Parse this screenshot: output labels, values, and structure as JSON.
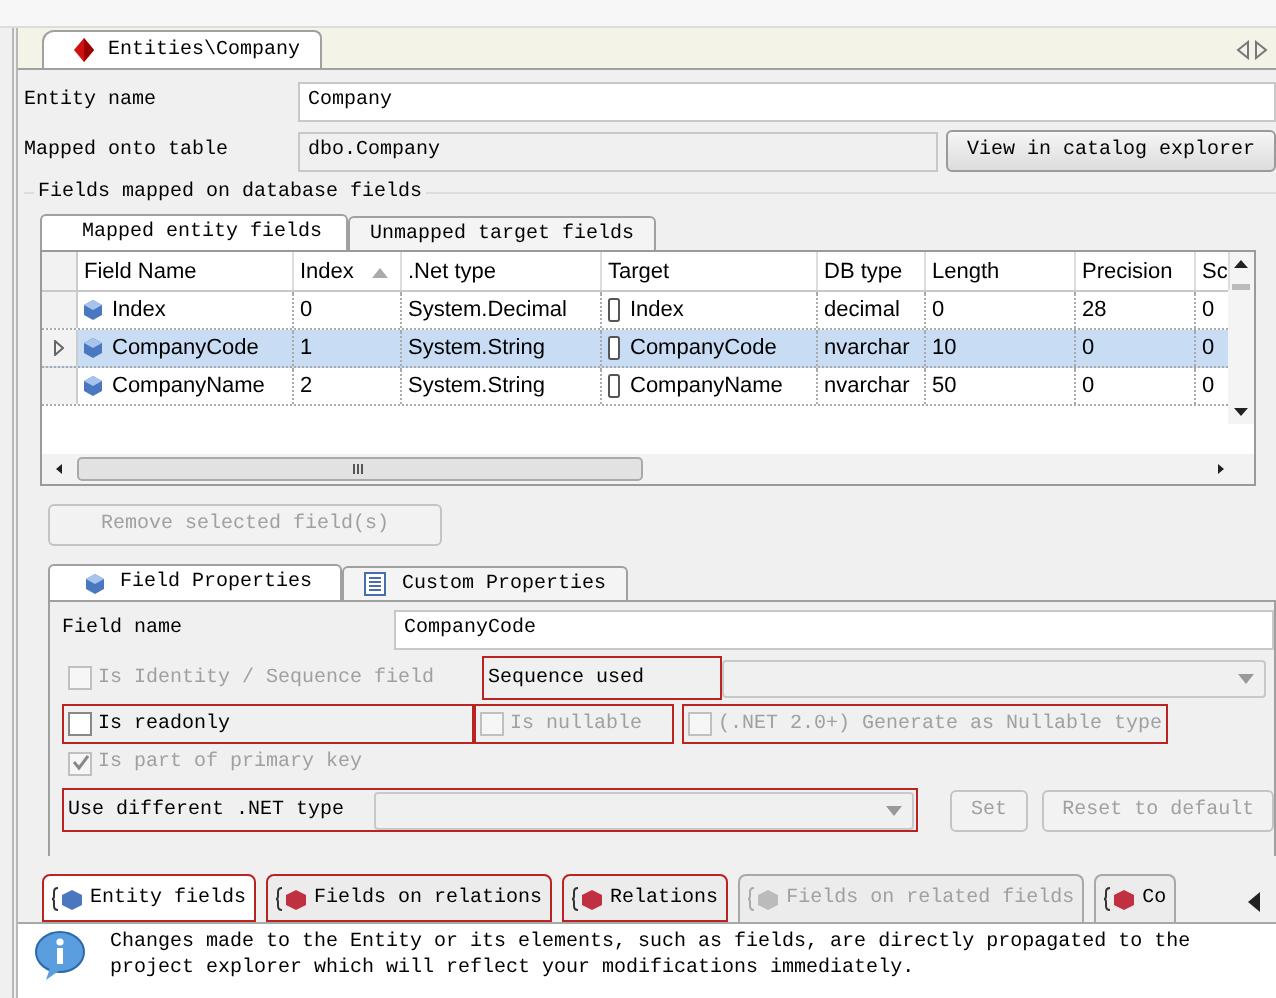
{
  "document_tab": {
    "label": "Entities\\Company",
    "selected": true
  },
  "entity_name": {
    "label": "Entity name",
    "value": "Company"
  },
  "mapped_table": {
    "label": "Mapped onto table",
    "value": "dbo.Company",
    "button": "View in catalog explorer"
  },
  "fields_group": {
    "title": "Fields mapped on database fields",
    "tabs": [
      {
        "label": "Mapped entity fields",
        "selected": true
      },
      {
        "label": "Unmapped target fields",
        "selected": false
      }
    ],
    "table": {
      "columns": [
        {
          "label": "Field Name",
          "sorted": false
        },
        {
          "label": "Index",
          "sorted": true
        },
        {
          "label": ".Net type",
          "sorted": false
        },
        {
          "label": "Target",
          "sorted": false
        },
        {
          "label": "DB type",
          "sorted": false
        },
        {
          "label": "Length",
          "sorted": false
        },
        {
          "label": "Precision",
          "sorted": false
        },
        {
          "label": "Sc",
          "sorted": false
        }
      ],
      "rows": [
        {
          "current": false,
          "selected": false,
          "cells": [
            "Index",
            "0",
            "System.Decimal",
            "Index",
            "decimal",
            "0",
            "28",
            "0"
          ]
        },
        {
          "current": true,
          "selected": true,
          "cells": [
            "CompanyCode",
            "1",
            "System.String",
            "CompanyCode",
            "nvarchar",
            "10",
            "0",
            "0"
          ]
        },
        {
          "current": false,
          "selected": false,
          "cells": [
            "CompanyName",
            "2",
            "System.String",
            "CompanyName",
            "nvarchar",
            "50",
            "0",
            "0"
          ]
        }
      ]
    },
    "remove_button": {
      "label": "Remove selected field(s)",
      "disabled": true
    }
  },
  "field_properties": {
    "tabs": [
      {
        "label": "Field Properties",
        "selected": true,
        "kind": "field"
      },
      {
        "label": "Custom Properties",
        "selected": false,
        "kind": "custom"
      }
    ],
    "field_name": {
      "label": "Field name",
      "value": "CompanyCode"
    },
    "is_identity": {
      "label": "Is Identity / Sequence field",
      "checked": false,
      "disabled": true,
      "highlighted": false
    },
    "sequence": {
      "label": "Sequence used",
      "highlighted": true
    },
    "is_readonly": {
      "label": "Is readonly",
      "checked": false,
      "disabled": false,
      "highlighted": true
    },
    "is_nullable": {
      "label": "Is nullable",
      "checked": false,
      "disabled": true,
      "highlighted": true
    },
    "nullable_type": {
      "label": "(.NET 2.0+) Generate as Nullable type",
      "checked": false,
      "disabled": true,
      "highlighted": true
    },
    "primary_key": {
      "label": "Is part of primary key",
      "checked": true,
      "disabled": true,
      "highlighted": false
    },
    "net_type": {
      "label": "Use different .NET type",
      "highlighted": true
    },
    "buttons": [
      {
        "label": "Set",
        "disabled": true
      },
      {
        "label": "Reset to default",
        "disabled": true
      }
    ]
  },
  "bottom_tabs": [
    {
      "label": "Entity fields",
      "selected": true,
      "disabled": false,
      "highlighted": true
    },
    {
      "label": "Fields on relations",
      "selected": false,
      "disabled": false,
      "highlighted": true
    },
    {
      "label": "Relations",
      "selected": false,
      "disabled": false,
      "highlighted": true
    },
    {
      "label": "Fields on related fields",
      "selected": false,
      "disabled": true,
      "highlighted": false
    },
    {
      "label": "Co",
      "selected": false,
      "disabled": false,
      "highlighted": false
    }
  ],
  "info": {
    "text": "Changes made to the Entity or its elements, such as fields, are directly propagated to the project explorer which will reflect your modifications immediately."
  }
}
